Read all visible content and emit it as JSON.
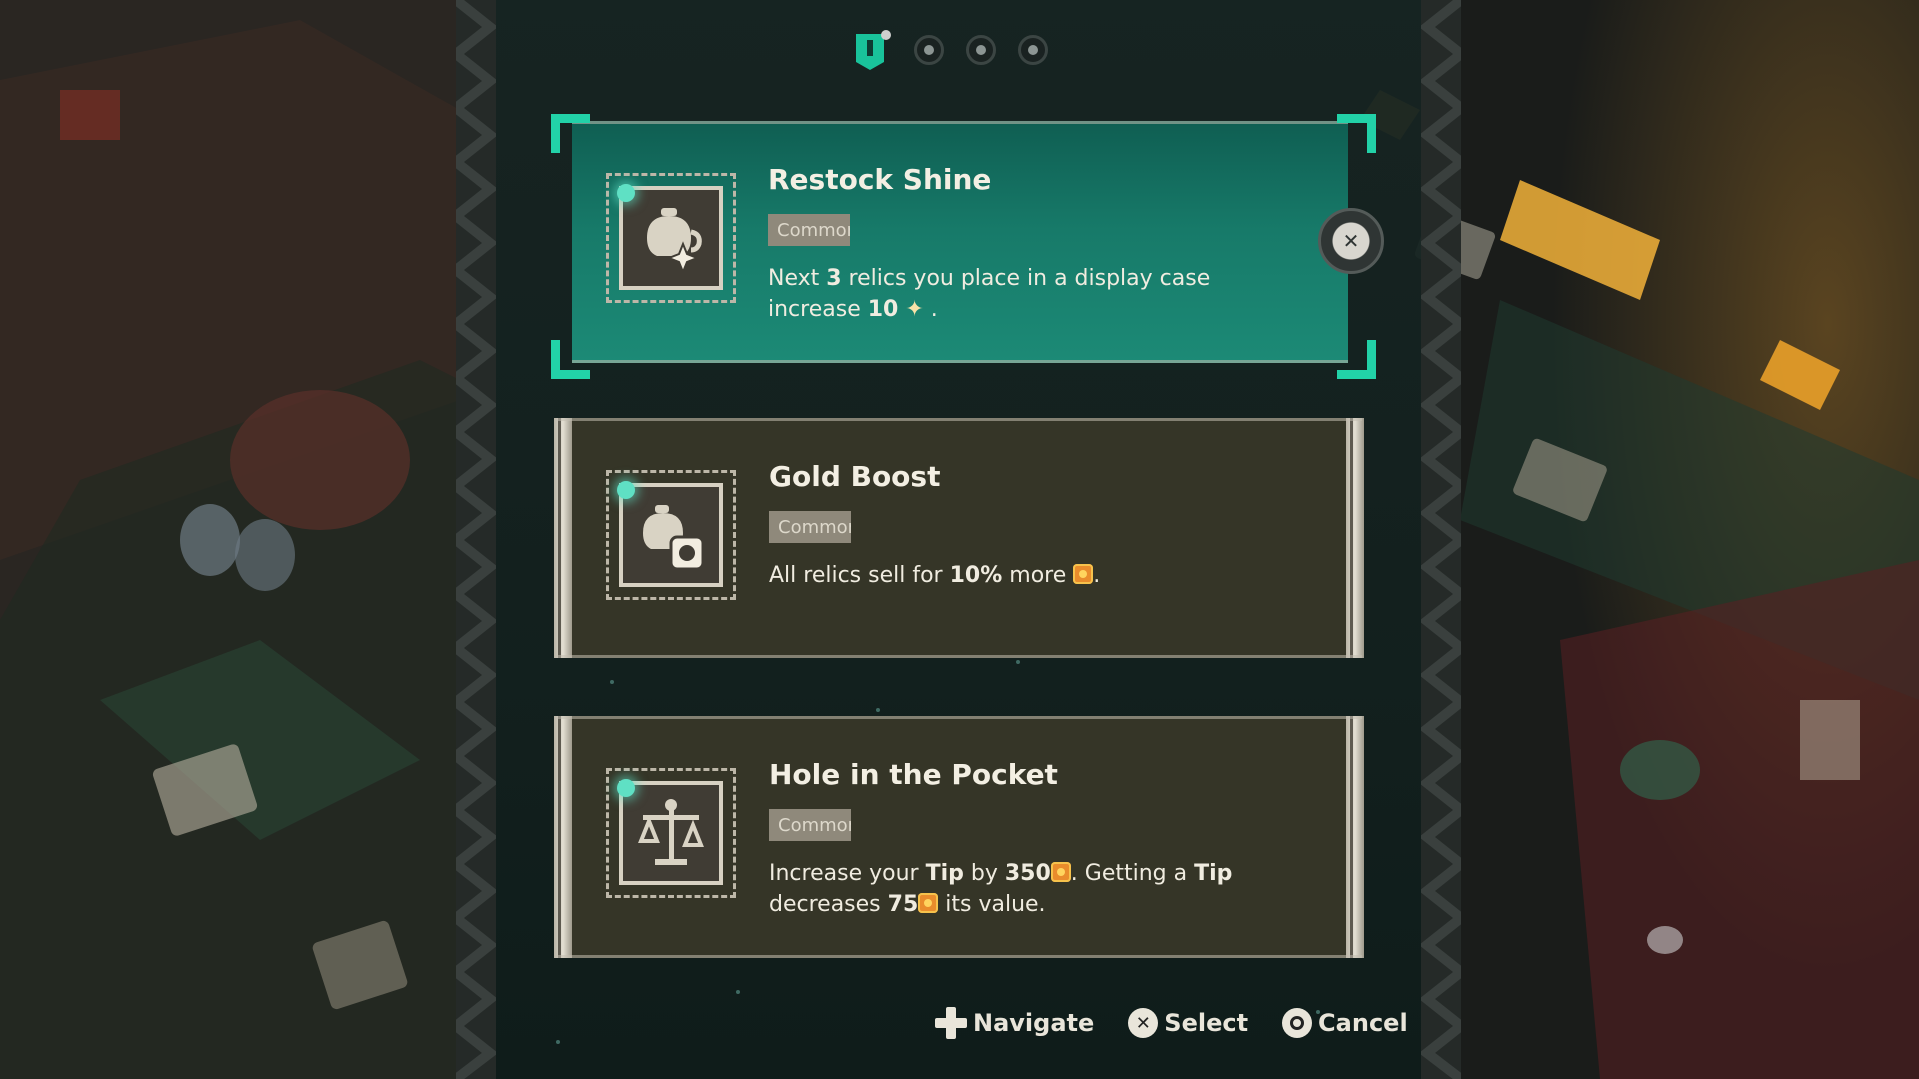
{
  "pagination": {
    "count": 4,
    "active_index": 0
  },
  "cards": [
    {
      "title": "Restock Shine",
      "rarity": "Common",
      "desc_before": "Next ",
      "desc_bold1": "3",
      "desc_mid": " relics you place in a display case increase ",
      "desc_bold2": "10",
      "desc_after": " .",
      "icon": "teapot-sparkle-icon",
      "selected": true
    },
    {
      "title": "Gold Boost",
      "rarity": "Common",
      "desc_before": "All relics sell for ",
      "desc_bold1": "10%",
      "desc_mid": " more ",
      "desc_after": ".",
      "icon": "teapot-coin-icon",
      "selected": false
    },
    {
      "title": "Hole in the Pocket",
      "rarity": "Common",
      "desc_p1": "Increase your ",
      "desc_b1": "Tip",
      "desc_p2": " by ",
      "desc_b2": "350",
      "desc_p3": ". Getting a ",
      "desc_b3": "Tip",
      "desc_p4": " decreases ",
      "desc_b4": "75",
      "desc_p5": " its value.",
      "icon": "scales-icon",
      "selected": false
    }
  ],
  "footer": {
    "navigate": "Navigate",
    "select": "Select",
    "cancel": "Cancel"
  },
  "colors": {
    "accent": "#22d2a8",
    "selected_card": "#177a69",
    "card": "#353527",
    "coin": "#e98c2c"
  }
}
